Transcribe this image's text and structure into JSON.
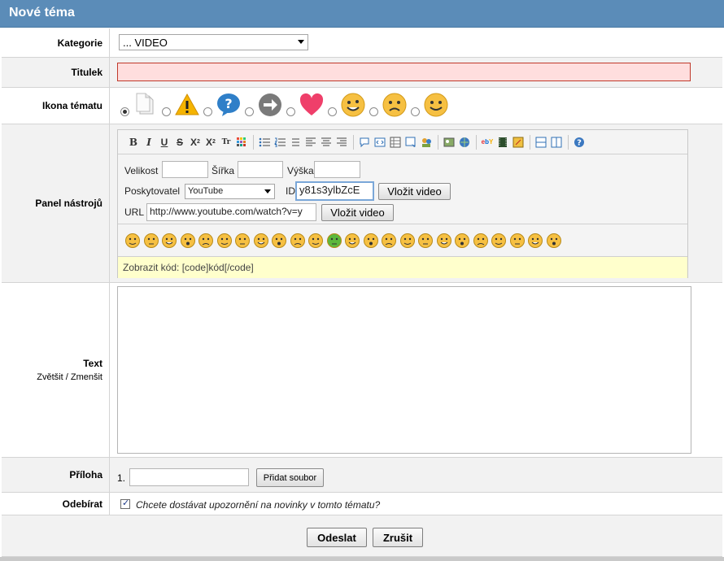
{
  "header": {
    "title": "Nové téma"
  },
  "category": {
    "label": "Kategorie",
    "selected": "... VIDEO"
  },
  "title_field": {
    "label": "Titulek",
    "value": ""
  },
  "topic_icon": {
    "label": "Ikona tématu",
    "options": [
      {
        "name": "page-icon",
        "selected": true
      },
      {
        "name": "warning-icon",
        "selected": false
      },
      {
        "name": "question-icon",
        "selected": false
      },
      {
        "name": "arrow-right-icon",
        "selected": false
      },
      {
        "name": "heart-icon",
        "selected": false
      },
      {
        "name": "smile-icon",
        "selected": false
      },
      {
        "name": "sad-icon",
        "selected": false
      },
      {
        "name": "happy-icon",
        "selected": false
      }
    ]
  },
  "toolbar": {
    "label": "Panel nástrojů",
    "buttons": {
      "bold": "B",
      "italic": "I",
      "underline": "U",
      "strike": "S",
      "subscript": "X",
      "superscript": "X",
      "font": "Tr"
    },
    "video_form": {
      "size_label": "Velikost",
      "width_label": "Šířka",
      "height_label": "Výška",
      "provider_label": "Poskytovatel",
      "provider_selected": "YouTube",
      "id_label": "ID",
      "id_value": "y81s3ylbZcE",
      "insert_button": "Vložit video",
      "url_label": "URL",
      "url_value": "http://www.youtube.com/watch?v=y",
      "insert_button_2": "Vložit video"
    },
    "smileys_count": 24,
    "hint": "Zobrazit kód: [code]kód[/code]"
  },
  "text": {
    "label": "Text",
    "enlarge": "Zvětšit",
    "separator": "/",
    "shrink": "Zmenšit",
    "value": ""
  },
  "attachment": {
    "label": "Příloha",
    "index": "1.",
    "add_button": "Přidat soubor"
  },
  "subscribe": {
    "label": "Odebírat",
    "checked": true,
    "question": "Chcete dostávat upozornění na novinky v tomto tématu?"
  },
  "actions": {
    "submit": "Odeslat",
    "cancel": "Zrušit"
  },
  "colors": {
    "header_bg": "#5b8cb8",
    "title_invalid_bg": "#ffdede",
    "title_invalid_border": "#c0392b",
    "hint_bg": "#ffffcc"
  }
}
